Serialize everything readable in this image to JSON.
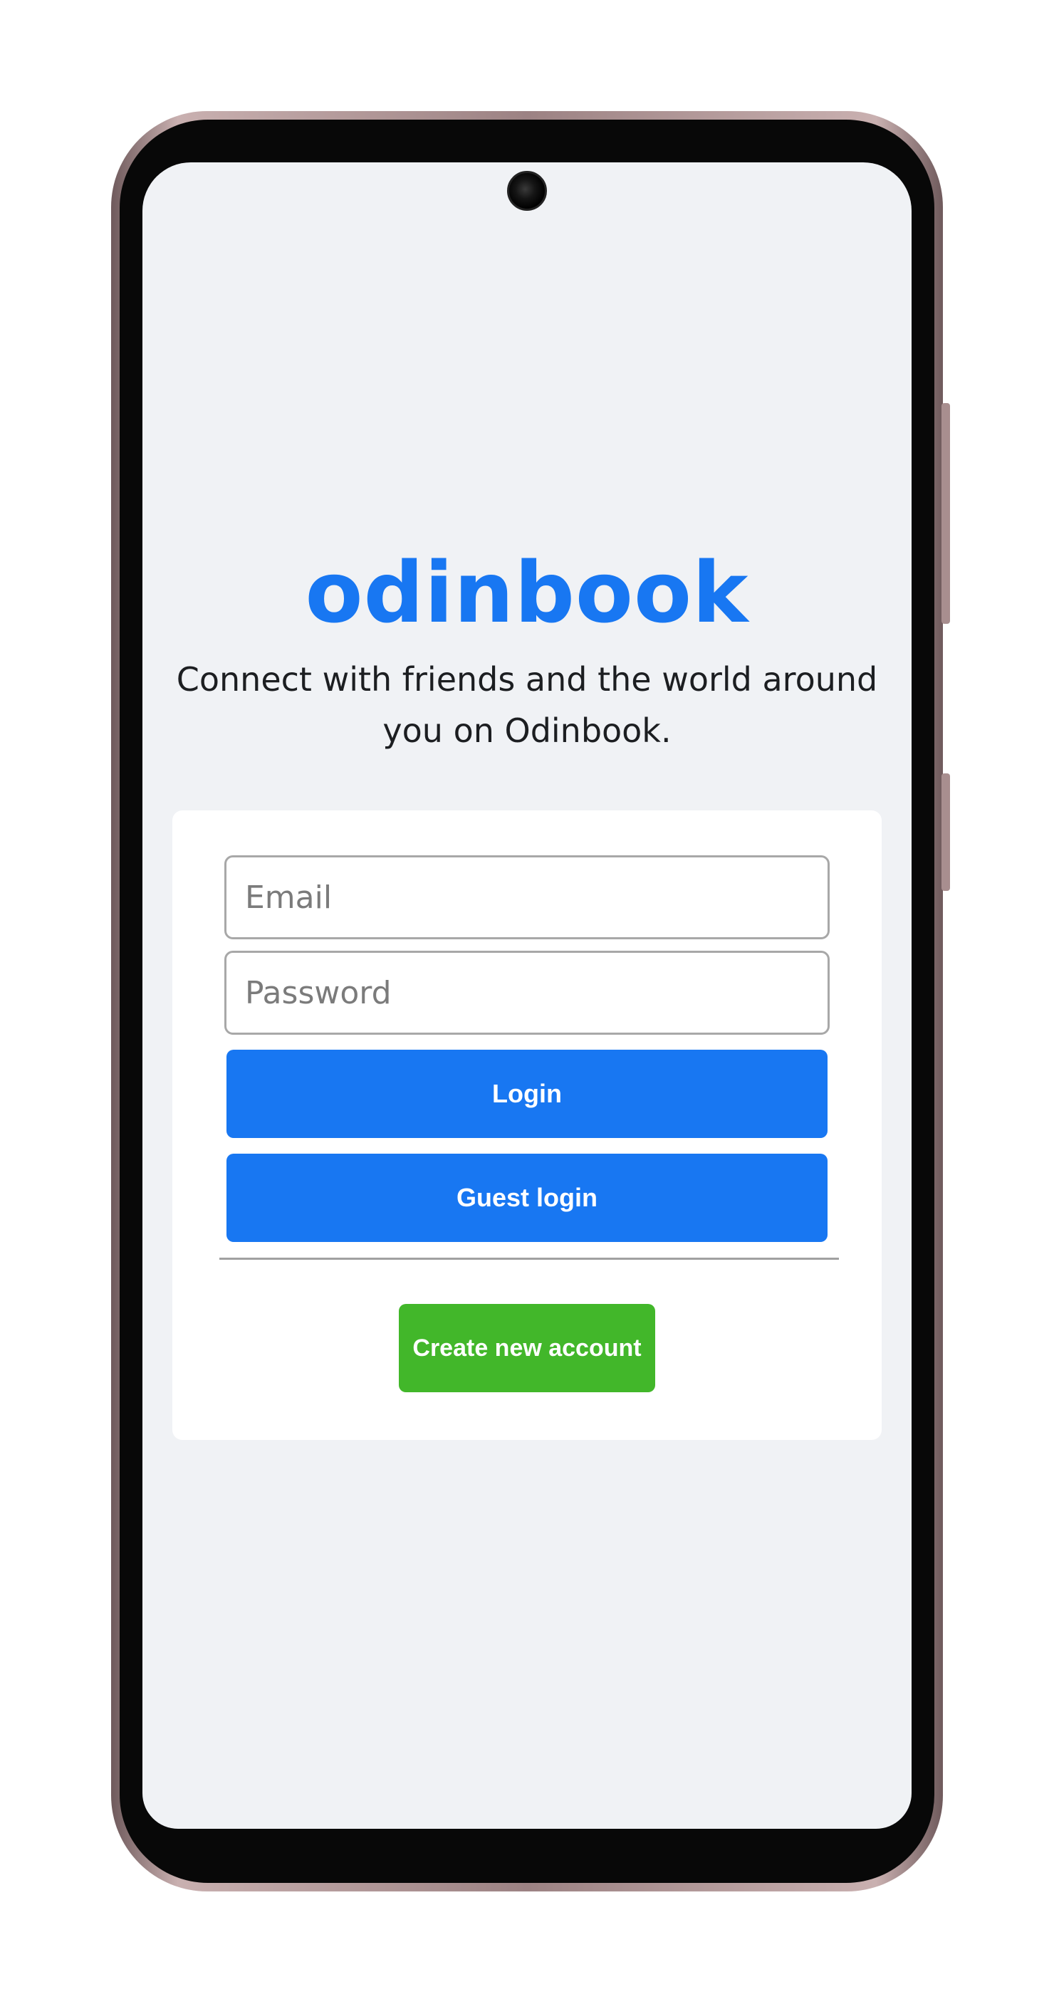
{
  "app": {
    "logo_text": "odinbook",
    "tagline": "Connect with friends and the world around you on Odinbook."
  },
  "login_form": {
    "email": {
      "placeholder": "Email",
      "value": ""
    },
    "password": {
      "placeholder": "Password",
      "value": ""
    },
    "login_label": "Login",
    "guest_login_label": "Guest login",
    "create_account_label": "Create new account"
  },
  "colors": {
    "brand_blue": "#1877f2",
    "create_green": "#42b72a",
    "background": "#f0f2f5"
  },
  "icons": [
    "front-camera-icon"
  ]
}
